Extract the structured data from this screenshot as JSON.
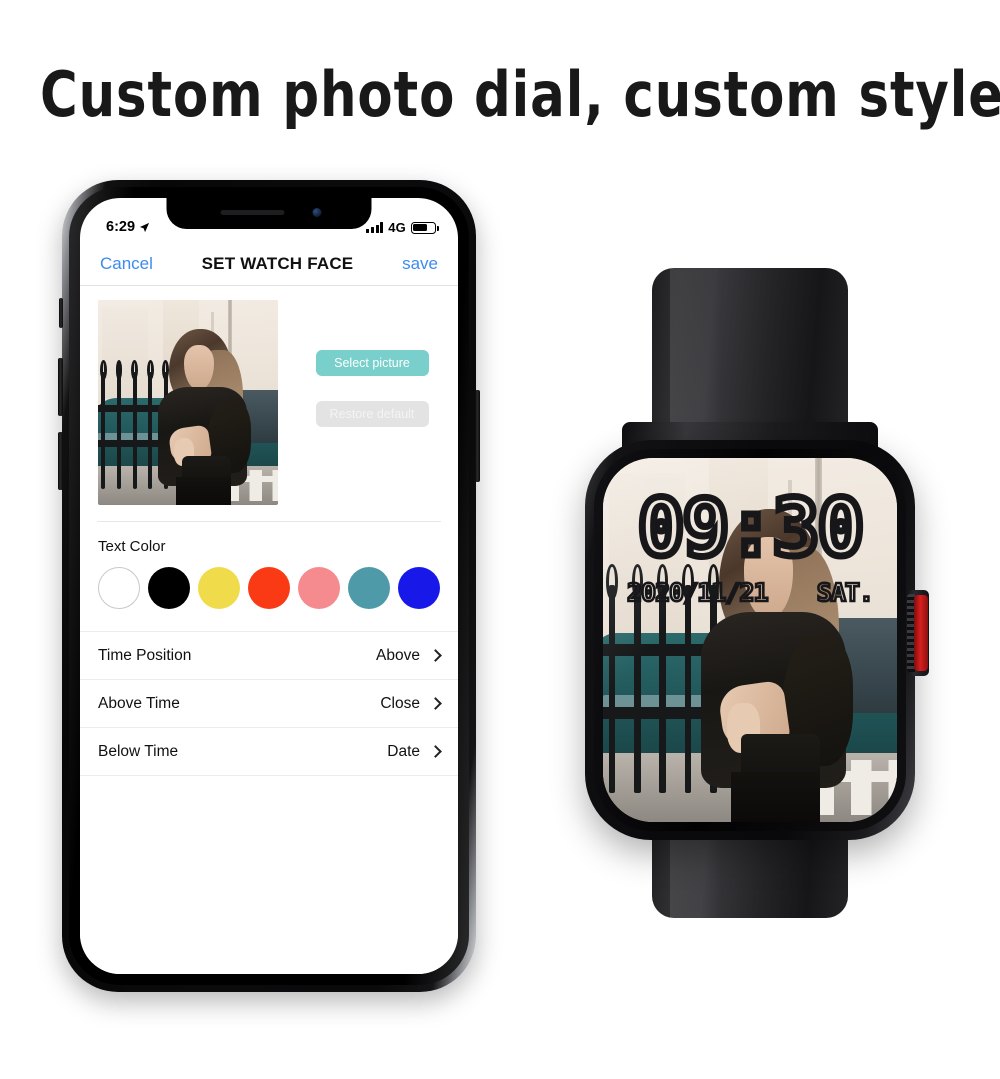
{
  "headline": "Custom photo dial, custom style",
  "phone": {
    "status_bar": {
      "time": "6:29",
      "location_icon": "location-arrow-icon",
      "signal_icon": "signal-bars-icon",
      "network": "4G",
      "battery_icon": "battery-icon",
      "battery_level_percent": 58
    },
    "nav_bar": {
      "cancel_label": "Cancel",
      "title": "SET WATCH FACE",
      "save_label": "save",
      "link_color": "#3d8bf0"
    },
    "actions": {
      "select_picture_label": "Select picture",
      "select_picture_color": "#79cfcb",
      "restore_default_label": "Restore default",
      "restore_default_color": "#e3e3e3"
    },
    "text_color": {
      "label": "Text Color",
      "swatches": [
        {
          "name": "white",
          "hex": "#ffffff",
          "selected": false
        },
        {
          "name": "black",
          "hex": "#000000",
          "selected": false
        },
        {
          "name": "yellow",
          "hex": "#f0dc4a",
          "selected": false
        },
        {
          "name": "red",
          "hex": "#f93a14",
          "selected": false
        },
        {
          "name": "pink",
          "hex": "#f58b8f",
          "selected": false
        },
        {
          "name": "teal",
          "hex": "#4e9aa8",
          "selected": false
        },
        {
          "name": "blue",
          "hex": "#1818e8",
          "selected": false
        }
      ]
    },
    "settings_rows": [
      {
        "label": "Time Position",
        "value": "Above"
      },
      {
        "label": "Above Time",
        "value": "Close"
      },
      {
        "label": "Below Time",
        "value": "Date"
      }
    ]
  },
  "watch": {
    "face": {
      "time": "09:30",
      "date": "2020/11/21",
      "weekday": "SAT."
    },
    "crown_accent_color": "#d81f1f"
  }
}
